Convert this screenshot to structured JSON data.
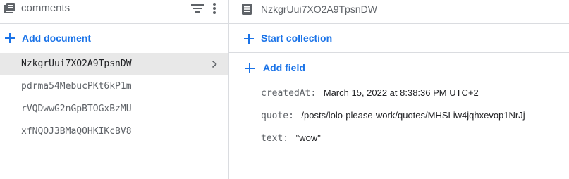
{
  "collection": {
    "title": "comments",
    "add_document_label": "Add document",
    "documents": [
      "NzkgrUui7XO2A9TpsnDW",
      "pdrma54MebucPKt6kP1m",
      "rVQDwwG2nGpBTOGxBzMU",
      "xfNQOJ3BMaQOHKIKcBV8"
    ],
    "selected_index": 0
  },
  "document": {
    "title": "NzkgrUui7XO2A9TpsnDW",
    "start_collection_label": "Start collection",
    "add_field_label": "Add field",
    "fields": [
      {
        "key": "createdAt:",
        "value": "March 15, 2022 at 8:38:36 PM UTC+2"
      },
      {
        "key": "quote:",
        "value": "/posts/lolo-please-work/quotes/MHSLiw4jqhxevop1NrJj"
      },
      {
        "key": "text:",
        "value": "\"wow\""
      }
    ]
  },
  "colors": {
    "accent": "#1a73e8",
    "selected_row": "#e8e8e8",
    "divider": "#dadce0"
  },
  "icons": [
    "collection-icon",
    "filter-icon",
    "more-vert-icon",
    "add-icon",
    "chevron-right-icon",
    "document-icon"
  ]
}
